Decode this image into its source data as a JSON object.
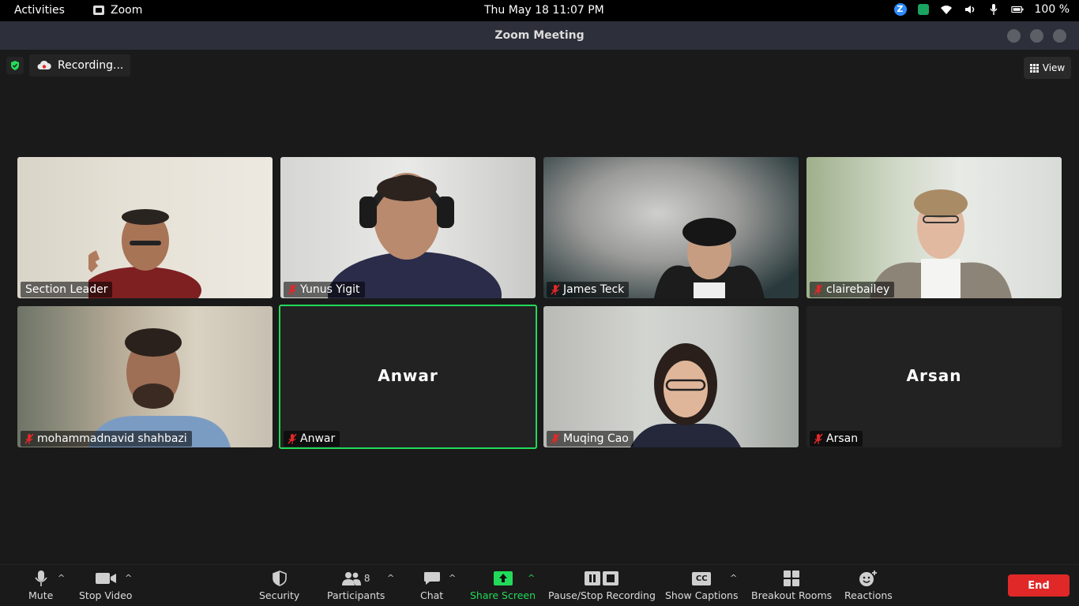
{
  "system_bar": {
    "activities": "Activities",
    "app_name": "Zoom",
    "clock": "Thu May 18  11:07 PM",
    "battery": "100 %"
  },
  "window": {
    "title": "Zoom Meeting"
  },
  "meeting": {
    "recording_label": "Recording...",
    "view_label": "View",
    "participants": [
      {
        "name": "Section Leader",
        "muted": false,
        "video": true
      },
      {
        "name": "Yunus Yigit",
        "muted": true,
        "video": true
      },
      {
        "name": "James Teck",
        "muted": true,
        "video": true
      },
      {
        "name": "clairebailey",
        "muted": true,
        "video": true
      },
      {
        "name": "mohammadnavid shahbazi",
        "muted": true,
        "video": true
      },
      {
        "name": "Anwar",
        "muted": true,
        "video": false,
        "active_speaker": true
      },
      {
        "name": "Muqing Cao",
        "muted": true,
        "video": true
      },
      {
        "name": "Arsan",
        "muted": true,
        "video": false
      }
    ]
  },
  "toolbar": {
    "mute": "Mute",
    "stop_video": "Stop Video",
    "security": "Security",
    "participants": "Participants",
    "participants_count": "8",
    "chat": "Chat",
    "share_screen": "Share Screen",
    "pause_stop_recording": "Pause/Stop Recording",
    "show_captions": "Show Captions",
    "captions_badge": "CC",
    "breakout_rooms": "Breakout Rooms",
    "reactions": "Reactions",
    "end": "End"
  },
  "colors": {
    "accent_green": "#23d959",
    "end_red": "#e02828",
    "zoom_blue": "#2d8cff"
  }
}
